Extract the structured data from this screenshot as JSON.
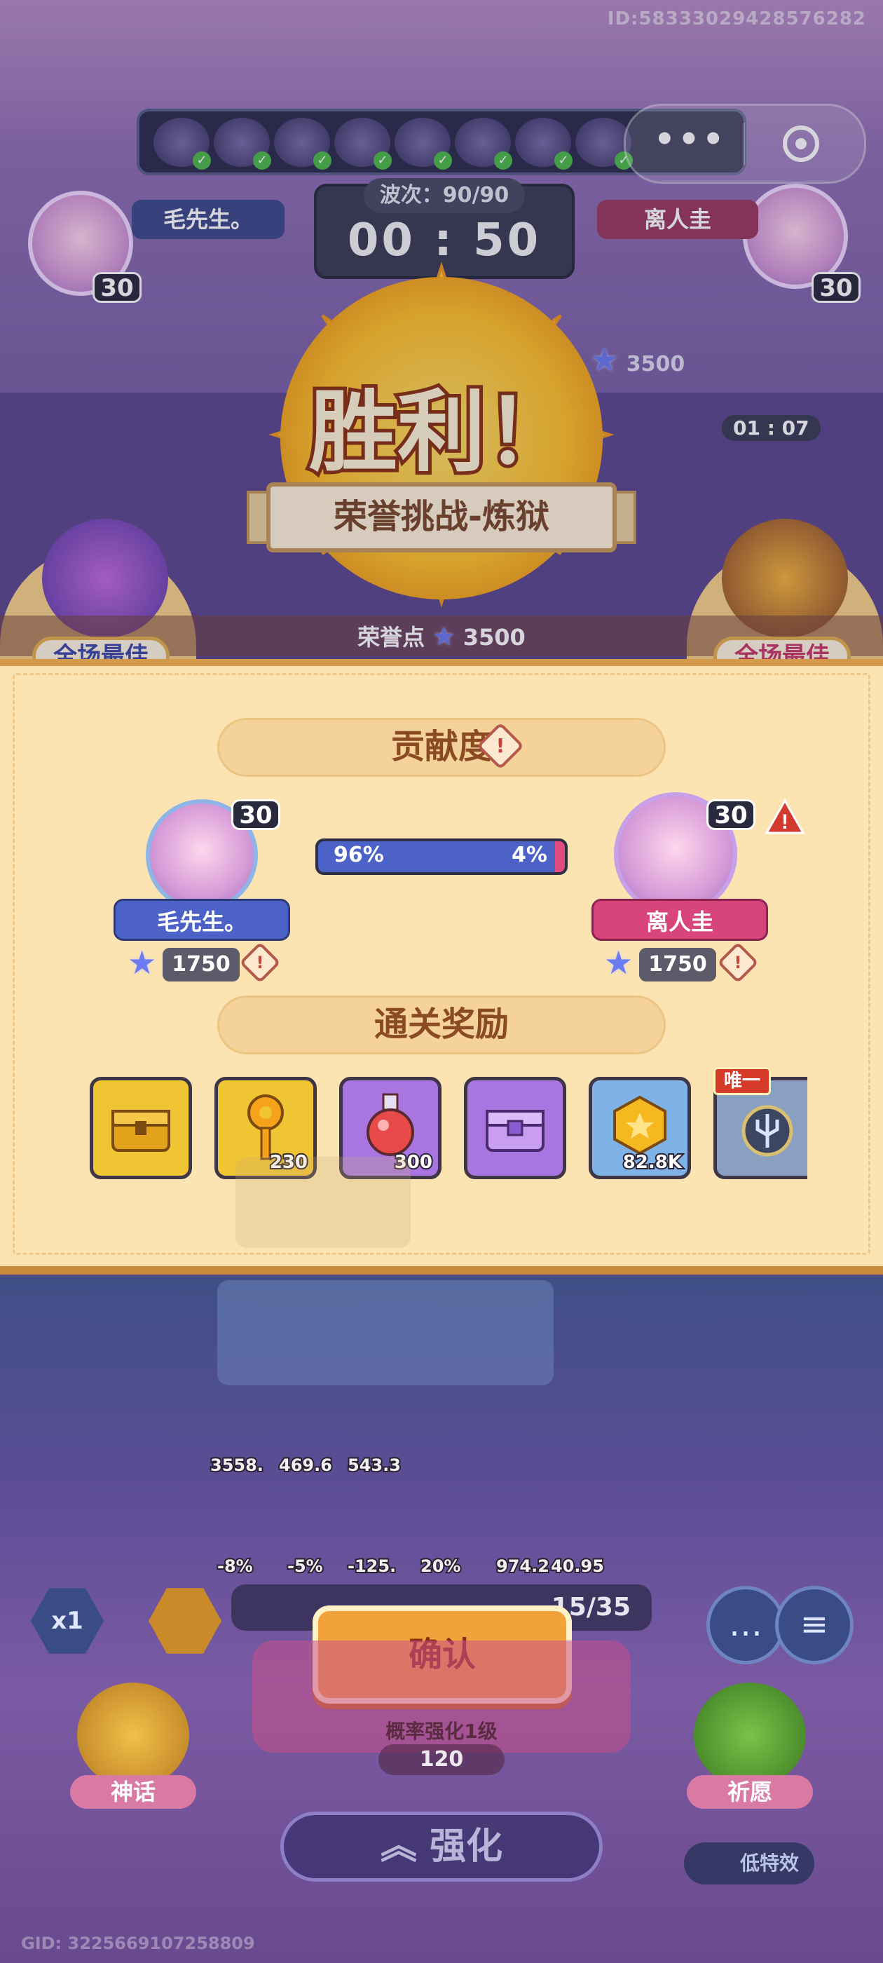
{
  "header": {
    "id_text": "ID:5833302942857628​2",
    "gid_text": "GID: 3225669107258809"
  },
  "match": {
    "wave_label": "波次：90/90",
    "timer": "00 : 50",
    "left_player": {
      "name": "毛先生。",
      "level": "30"
    },
    "right_player": {
      "name": "离人圭",
      "level": "30"
    },
    "right_points": "3500",
    "side_timer": "01 : 07"
  },
  "result": {
    "title": "胜利！",
    "mode": "荣誉挑战-炼狱",
    "honor_label": "荣誉点",
    "honor_value": "3500",
    "mvp_left": "全场最佳",
    "mvp_right": "全场最佳"
  },
  "contribution": {
    "heading": "贡献度",
    "percent_left": "96%",
    "percent_right": "4%",
    "share_left": 0.96,
    "left": {
      "name": "毛先生。",
      "level": "30",
      "score": "1750"
    },
    "right": {
      "name": "离人圭",
      "level": "30",
      "score": "1750"
    }
  },
  "rewards": {
    "heading": "通关奖励",
    "items": [
      {
        "icon": "gold-chest-icon",
        "count": ""
      },
      {
        "icon": "key-icon",
        "count": "230"
      },
      {
        "icon": "potion-icon",
        "count": "300"
      },
      {
        "icon": "purple-chest-icon",
        "count": ""
      },
      {
        "icon": "coin-icon",
        "count": "82.8K"
      },
      {
        "icon": "trident-medal-icon",
        "count": "",
        "tag": "唯一"
      }
    ]
  },
  "stats": {
    "row1": [
      "3558.",
      "469.6",
      "543.3"
    ],
    "row2": [
      "-8%",
      "-5%",
      "-125.",
      "20%",
      "974.2",
      "40.95"
    ]
  },
  "bottom": {
    "confirm": "确认",
    "resource_right": "15/35",
    "upgrade_caption": "概率强化1级",
    "upgrade_cost": "120",
    "enhance": "强化",
    "myth": "神话",
    "pray": "祈愿",
    "speed": "x1",
    "low_effect": "低特效"
  },
  "colors": {
    "panel_bg": "#fbe4b2",
    "blue_player": "#4c62c6",
    "pink_player": "#e14a7f",
    "confirm": "#f2a23a"
  }
}
